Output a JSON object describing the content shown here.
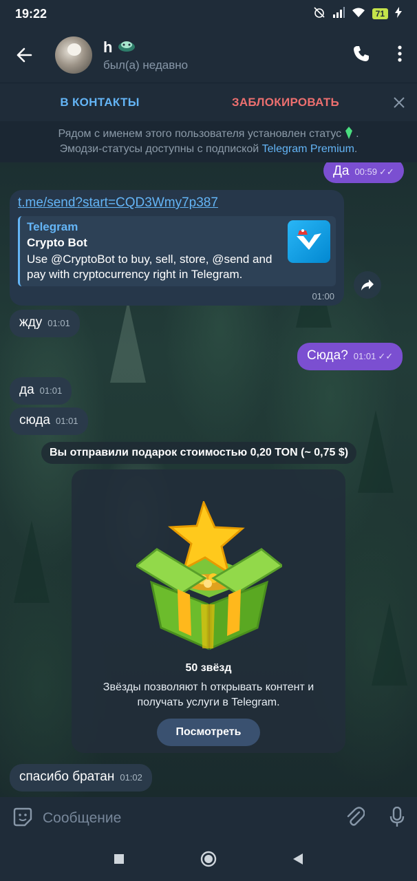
{
  "status": {
    "time": "19:22",
    "battery": "71"
  },
  "header": {
    "name": "h",
    "subtitle": "был(а) недавно"
  },
  "actions": {
    "add_contact": "В КОНТАКТЫ",
    "block": "ЗАБЛОКИРОВАТЬ"
  },
  "notice": {
    "line1": "Рядом с именем этого пользователя установлен статус",
    "line2_prefix": "Эмодзи-статусы доступны с подпиской ",
    "line2_link": "Telegram Premium",
    "line2_suffix": "."
  },
  "messages": [
    {
      "direction": "out",
      "text": "Да",
      "time": "00:59"
    },
    {
      "direction": "in",
      "link": "t.me/send?start=CQD3Wmy7p387",
      "preview_site": "Telegram",
      "preview_title": "Crypto Bot",
      "preview_desc": "Use @CryptoBot to buy, sell, store, @send and pay with cryptocurrency right in Telegram.",
      "time": "01:00"
    },
    {
      "direction": "in",
      "text": "жду",
      "time": "01:01"
    },
    {
      "direction": "out",
      "text": "Сюда?",
      "time": "01:01"
    },
    {
      "direction": "in",
      "text": "да",
      "time": "01:01"
    },
    {
      "direction": "in",
      "text": "сюда",
      "time": "01:01"
    },
    {
      "direction": "in",
      "text": "спасибо братан",
      "time": "01:02"
    }
  ],
  "service": {
    "text": "Вы отправили подарок стоимостью 0,20 TON (~ 0,75 $)"
  },
  "gift": {
    "title": "50 звёзд",
    "desc_line1": "Звёзды позволяют h открывать контент и",
    "desc_line2": "получать услуги в Telegram.",
    "button": "Посмотреть"
  },
  "input": {
    "placeholder": "Сообщение"
  },
  "colors": {
    "accent": "#64b5f6",
    "danger": "#ec6f6f",
    "outgoing": "#7b4fd1",
    "incoming": "#2a3a4a"
  }
}
